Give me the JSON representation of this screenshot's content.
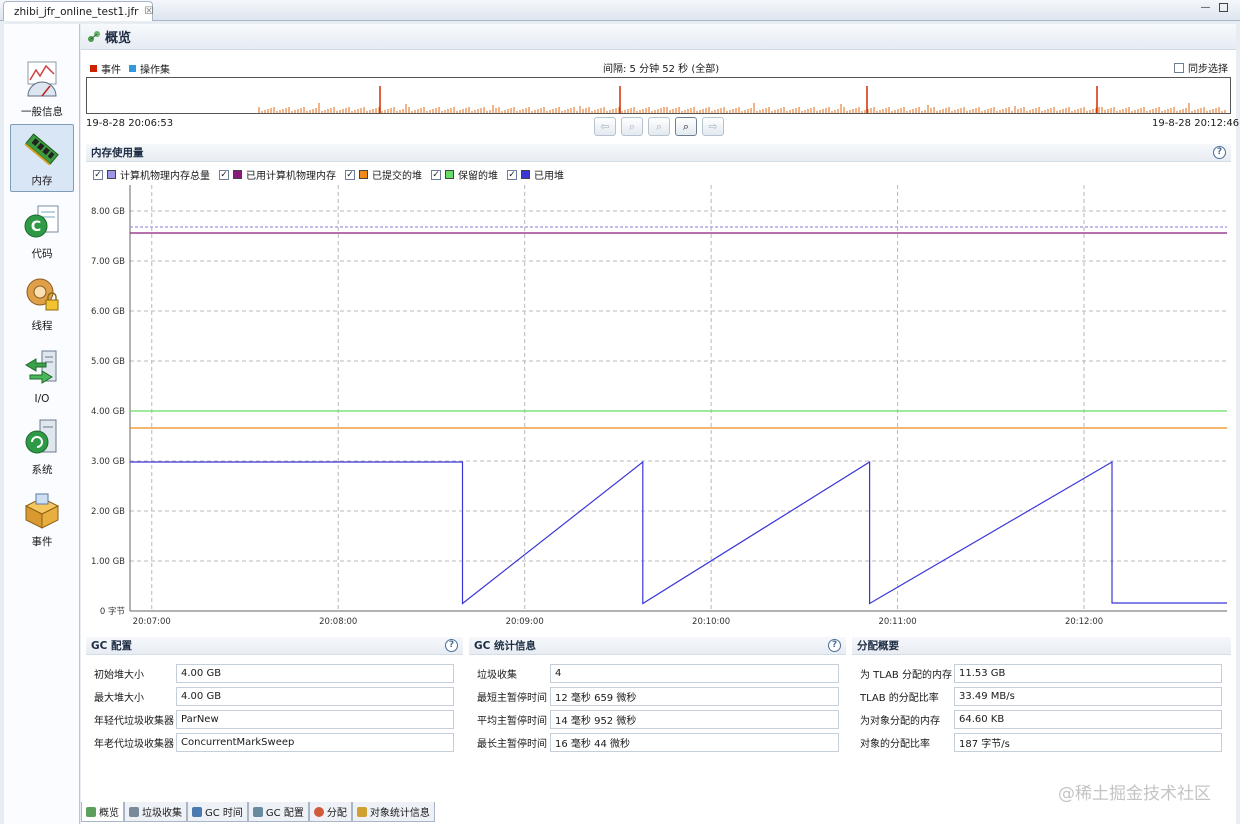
{
  "editor": {
    "tab_title": "zhibi_jfr_online_test1.jfr",
    "close_symbol": "☒",
    "minimize_symbol": "—",
    "maximize_symbol": ""
  },
  "nav": {
    "items": [
      {
        "label": "一般信息",
        "icon": "gauge-chart-icon"
      },
      {
        "label": "内存",
        "icon": "memory-chip-icon"
      },
      {
        "label": "代码",
        "icon": "code-class-icon"
      },
      {
        "label": "线程",
        "icon": "gear-lock-icon"
      },
      {
        "label": "I/O",
        "icon": "server-arrows-icon"
      },
      {
        "label": "系统",
        "icon": "system-server-icon"
      },
      {
        "label": "事件",
        "icon": "box-events-icon"
      }
    ]
  },
  "page": {
    "title": "概览",
    "title_icon": "overview-icon"
  },
  "timeline": {
    "legend": [
      {
        "label": "事件",
        "color": "#cc2200"
      },
      {
        "label": "操作集",
        "color": "#3399dd"
      }
    ],
    "interval_text": "间隔: 5 分钟 52 秒 (全部)",
    "sync_label": "同步选择",
    "start_time": "19-8-28 20:06:53",
    "end_time": "19-8-28 20:12:46",
    "spike_color": "#e06a10",
    "major_spike_color": "#d42a00"
  },
  "memory_section": {
    "title": "内存使用量",
    "help": "?"
  },
  "chart_data": {
    "type": "line",
    "title": "内存使用量",
    "xlabel": "",
    "ylabel": "",
    "x_ticks": [
      "20:07:00",
      "20:08:00",
      "20:09:00",
      "20:10:00",
      "20:11:00",
      "20:12:00"
    ],
    "y_ticks": [
      "0 字节",
      "1.00 GB",
      "2.00 GB",
      "3.00 GB",
      "4.00 GB",
      "5.00 GB",
      "6.00 GB",
      "7.00 GB",
      "8.00 GB"
    ],
    "ylim": [
      0,
      8.0
    ],
    "x_range": [
      "20:06:53",
      "20:12:46"
    ],
    "grid": true,
    "series": [
      {
        "name": "计算机物理内存总量",
        "color": "#9d95e8",
        "checked": true,
        "style": "dashed",
        "points": [
          [
            "20:06:53",
            7.68
          ],
          [
            "20:12:46",
            7.68
          ]
        ]
      },
      {
        "name": "已用计算机物理内存",
        "color": "#8a1a7a",
        "checked": true,
        "style": "solid",
        "points": [
          [
            "20:06:53",
            7.56
          ],
          [
            "20:12:46",
            7.56
          ]
        ]
      },
      {
        "name": "已提交的堆",
        "color": "#f08a1a",
        "checked": true,
        "style": "solid",
        "points": [
          [
            "20:06:53",
            3.66
          ],
          [
            "20:12:46",
            3.66
          ]
        ]
      },
      {
        "name": "保留的堆",
        "color": "#66dd66",
        "checked": true,
        "style": "solid",
        "points": [
          [
            "20:06:53",
            4.0
          ],
          [
            "20:12:46",
            4.0
          ]
        ]
      },
      {
        "name": "已用堆",
        "color": "#3b36d6",
        "checked": true,
        "style": "solid",
        "points": [
          [
            "20:06:53",
            2.98
          ],
          [
            "20:08:40",
            2.98
          ],
          [
            "20:08:40",
            0.15
          ],
          [
            "20:09:38",
            2.98
          ],
          [
            "20:09:38",
            0.15
          ],
          [
            "20:10:51",
            2.98
          ],
          [
            "20:10:51",
            0.15
          ],
          [
            "20:12:09",
            2.98
          ],
          [
            "20:12:09",
            0.16
          ],
          [
            "20:12:46",
            0.16
          ]
        ]
      }
    ]
  },
  "gc_config": {
    "title": "GC 配置",
    "help": "?",
    "rows": [
      {
        "label": "初始堆大小",
        "value": "4.00 GB"
      },
      {
        "label": "最大堆大小",
        "value": "4.00 GB"
      },
      {
        "label": "年轻代垃圾收集器",
        "value": "ParNew"
      },
      {
        "label": "年老代垃圾收集器",
        "value": "ConcurrentMarkSweep"
      }
    ]
  },
  "gc_stats": {
    "title": "GC 统计信息",
    "help": "?",
    "rows": [
      {
        "label": "垃圾收集",
        "value": "4"
      },
      {
        "label": "最短主暂停时间",
        "value": "12 毫秒 659 微秒"
      },
      {
        "label": "平均主暂停时间",
        "value": "14 毫秒 952 微秒"
      },
      {
        "label": "最长主暂停时间",
        "value": "16 毫秒 44 微秒"
      }
    ]
  },
  "alloc_summary": {
    "title": "分配概要",
    "rows": [
      {
        "label": "为 TLAB 分配的内存",
        "value": "11.53 GB"
      },
      {
        "label": "TLAB 的分配比率",
        "value": "33.49 MB/s"
      },
      {
        "label": "为对象分配的内存",
        "value": "64.60 KB"
      },
      {
        "label": "对象的分配比率",
        "value": "187 字节/s"
      }
    ]
  },
  "bottom_tabs": [
    {
      "label": "概览",
      "icon": "overview-icon",
      "active": true
    },
    {
      "label": "垃圾收集",
      "icon": "trash-icon",
      "active": false
    },
    {
      "label": "GC 时间",
      "icon": "gc-time-icon",
      "active": false
    },
    {
      "label": "GC 配置",
      "icon": "gc-config-icon",
      "active": false
    },
    {
      "label": "分配",
      "icon": "allocation-icon",
      "active": false
    },
    {
      "label": "对象统计信息",
      "icon": "object-stats-icon",
      "active": false
    }
  ],
  "watermark": "@稀土掘金技术社区"
}
